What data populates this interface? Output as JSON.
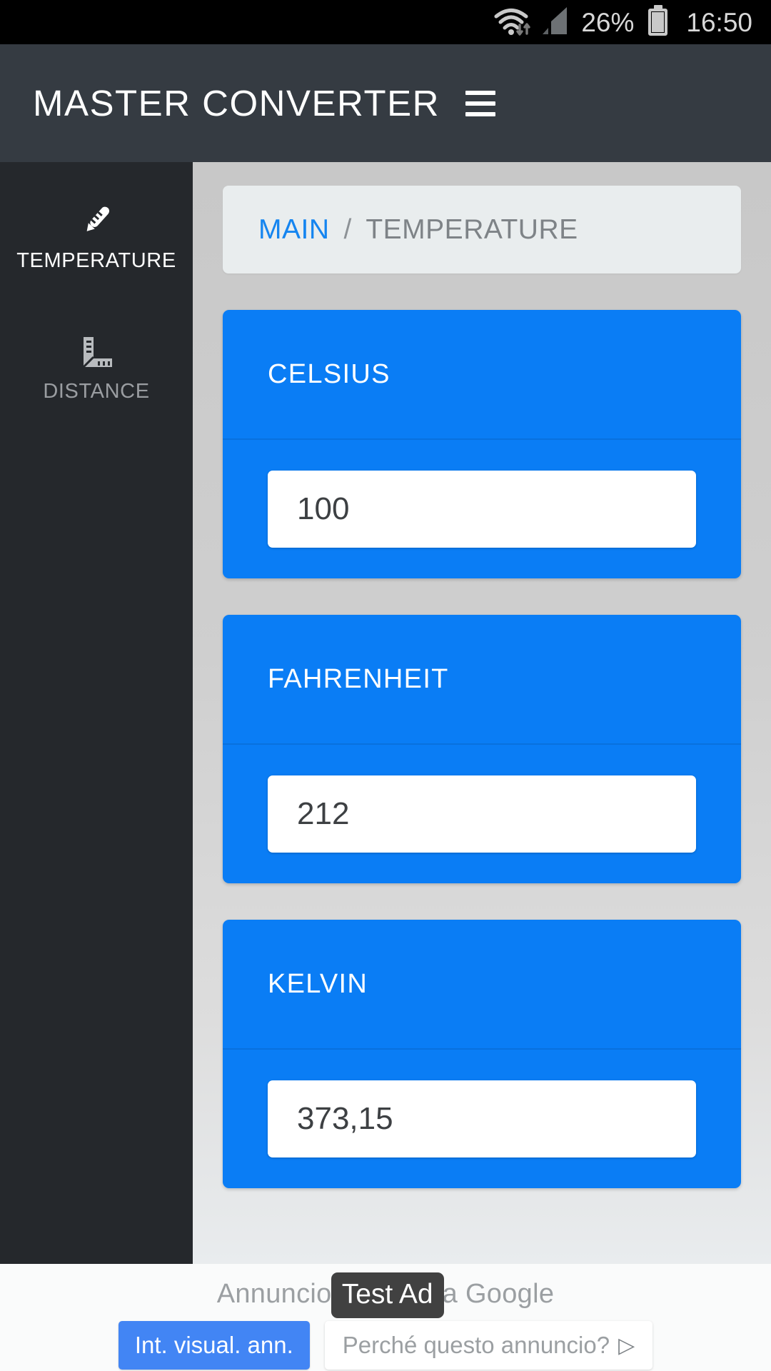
{
  "status_bar": {
    "wifi_icon": "wifi-icon",
    "data_arrows_icon": "data-transfer-icon",
    "signal_icon": "cellular-signal-icon",
    "battery_percent": "26%",
    "battery_icon": "battery-icon",
    "time": "16:50"
  },
  "app_bar": {
    "title": "MASTER CONVERTER",
    "menu_icon": "hamburger-menu-icon"
  },
  "sidebar": {
    "items": [
      {
        "label": "TEMPERATURE",
        "icon": "thermometer-icon",
        "active": true
      },
      {
        "label": "DISTANCE",
        "icon": "ruler-icon",
        "active": false
      }
    ]
  },
  "breadcrumb": {
    "root": "MAIN",
    "separator": "/",
    "current": "TEMPERATURE"
  },
  "converter": {
    "cards": [
      {
        "title": "CELSIUS",
        "value": "100"
      },
      {
        "title": "FAHRENHEIT",
        "value": "212"
      },
      {
        "title": "KELVIN",
        "value": "373,15"
      }
    ]
  },
  "ad_banner": {
    "attribution": "Annuncio inviato da Google",
    "test_badge": "Test Ad",
    "button_primary": "Int. visual. ann.",
    "button_secondary": "Perché questo annuncio?",
    "play_icon": "play-triangle-icon"
  },
  "colors": {
    "accent_blue": "#0a7df5",
    "link_blue": "#1585f0",
    "appbar": "#353b42",
    "sidebar": "#25282c",
    "ad_button_blue": "#4285f4"
  }
}
